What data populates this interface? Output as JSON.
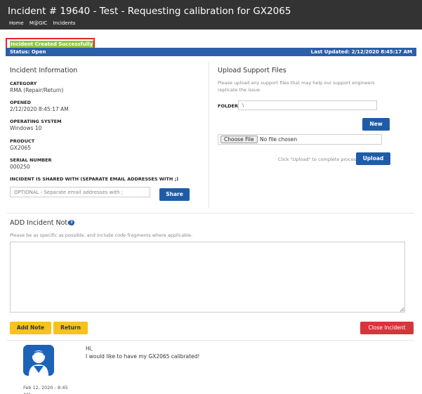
{
  "header": {
    "title": "Incident # 19640 - Test - Requesting calibration for GX2065",
    "breadcrumbs": [
      "Home",
      "M@GIC",
      "Incidents"
    ]
  },
  "alert": {
    "message": "Incident Created Successfully"
  },
  "status_bar": {
    "status": "Status: Open",
    "last_updated": "Last Updated: 2/12/2020 8:45:17 AM"
  },
  "incident_info": {
    "title": "Incident Information",
    "fields": [
      {
        "label": "CATEGORY",
        "value": "RMA (Repair/Return)"
      },
      {
        "label": "OPENED",
        "value": "2/12/2020 8:45:17 AM"
      },
      {
        "label": "OPERATING SYSTEM",
        "value": "Windows 10"
      },
      {
        "label": "PRODUCT",
        "value": "GX2065"
      },
      {
        "label": "SERIAL NUMBER",
        "value": "000250"
      }
    ],
    "share_label": "INCIDENT IS SHARED WITH (SEPARATE EMAIL ADDRESSES WITH ;)",
    "share_placeholder": "OPTIONAL - Separate email addresses with ;",
    "share_button": "Share"
  },
  "upload": {
    "title": "Upload Support Files",
    "hint": "Please upload any support files that may help our support engineers replicate the issue.",
    "folder_label": "FOLDER:",
    "folder_value": "\\",
    "new_button": "New",
    "choose_file": "Choose File",
    "no_file": "No file chosen",
    "upload_hint": "Click \"Upload\" to complete process.",
    "upload_button": "Upload"
  },
  "note": {
    "title": "ADD Incident Note",
    "help_icon": "question-circle-icon",
    "hint": "Please be as specific as possible, and include code fragments where applicable.",
    "add_button": "Add Note",
    "return_button": "Return",
    "close_button": "Close Incident"
  },
  "history": [
    {
      "avatar_icon": "user-avatar-icon",
      "lines": [
        "Hi,",
        "I would like to have my GX2065 calibrated!"
      ],
      "date_lines": [
        "Feb 12, 2020 - 8:45",
        "AM"
      ]
    }
  ],
  "colors": {
    "header_bg": "#333333",
    "status_bar": "#2b5fa8",
    "success": "#8dc63f",
    "alert_border": "#e8232a",
    "primary": "#1f5ca8",
    "warning": "#f6c21b",
    "danger": "#d9343b"
  }
}
